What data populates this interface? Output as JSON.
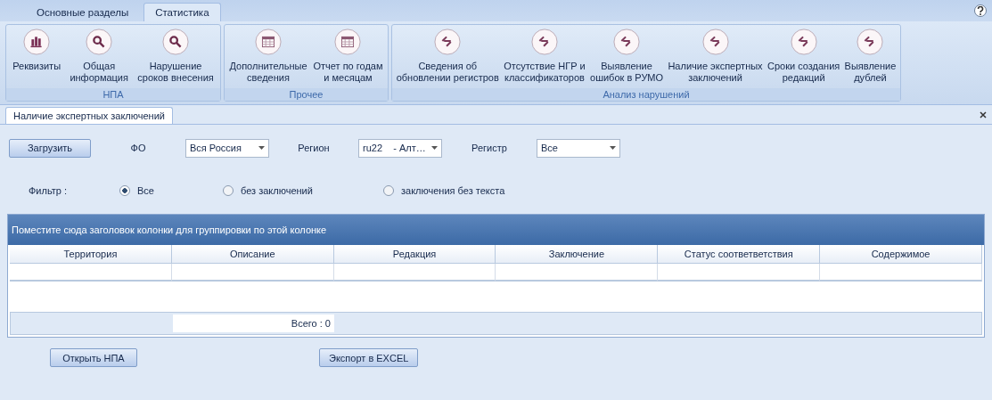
{
  "top_tabs": [
    {
      "label": "Основные разделы",
      "selected": false
    },
    {
      "label": "Статистика",
      "selected": true
    }
  ],
  "ribbon_groups": [
    {
      "title": "НПА",
      "buttons": [
        {
          "label": "Реквизиты",
          "kind": "chart"
        },
        {
          "label": "Общая\nинформация",
          "kind": "search"
        },
        {
          "label": "Нарушение\nсроков внесения",
          "kind": "search"
        }
      ]
    },
    {
      "title": "Прочее",
      "buttons": [
        {
          "label": "Дополнительные\nсведения",
          "kind": "table"
        },
        {
          "label": "Отчет по годам\nи месяцам",
          "kind": "table"
        }
      ]
    },
    {
      "title": "Анализ нарушений",
      "buttons": [
        {
          "label": "Сведения об\nобновлении регистров",
          "kind": "link"
        },
        {
          "label": "Отсутствие НГР и\nклассификаторов",
          "kind": "link"
        },
        {
          "label": "Выявление\nошибок в РУМО",
          "kind": "link"
        },
        {
          "label": "Наличие экспертных\nзаключений",
          "kind": "link"
        },
        {
          "label": "Сроки создания\nредакций",
          "kind": "link"
        },
        {
          "label": "Выявление\nдублей",
          "kind": "link"
        }
      ]
    }
  ],
  "document_tab": {
    "label": "Наличие экспертных заключений",
    "selected": true
  },
  "load_button": "Загрузить",
  "filters": [
    {
      "label": "ФО",
      "value": "Вся Россия"
    },
    {
      "label": "Регион",
      "value": "ru22    - Алт…"
    },
    {
      "label": "Регистр",
      "value": "Все"
    }
  ],
  "filter_label": "Фильтр :",
  "radio_options": [
    {
      "label": "Все",
      "selected": true
    },
    {
      "label": "без заключений",
      "selected": false
    },
    {
      "label": "заключения без текста",
      "selected": false
    }
  ],
  "group_panel": "Поместите сюда заголовок колонки для группировки по этой колонке",
  "table": {
    "columns": [
      "Территория",
      "Описание",
      "Редакция",
      "Заключение",
      "Статус соответветствия",
      "Содержимое"
    ],
    "footer_total": "Всего : 0"
  },
  "bottom_buttons": [
    "Открыть НПА",
    "Экспорт в EXCEL"
  ]
}
